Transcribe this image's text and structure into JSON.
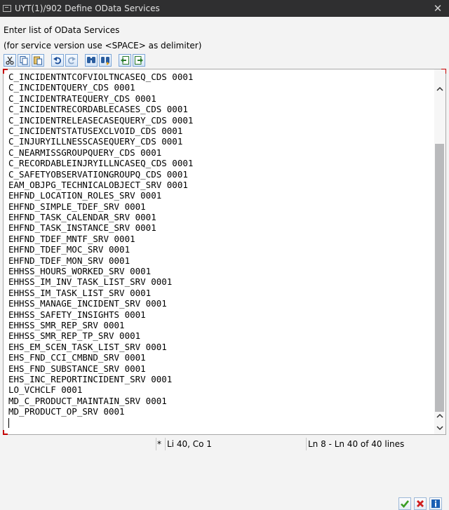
{
  "window": {
    "title": "UYT(1)/902 Define OData Services",
    "close_glyph": "✕"
  },
  "dialog": {
    "instruction": "Enter list of OData Services",
    "hint": "(for service version use <SPACE> as delimiter)"
  },
  "toolbar": [
    {
      "name": "cut-icon",
      "tooltip": "Cut"
    },
    {
      "name": "copy-icon",
      "tooltip": "Copy"
    },
    {
      "name": "paste-icon",
      "tooltip": "Paste"
    },
    {
      "name": "undo-icon",
      "tooltip": "Undo"
    },
    {
      "name": "redo-icon",
      "tooltip": "Redo"
    },
    {
      "name": "find-icon",
      "tooltip": "Find"
    },
    {
      "name": "find-next-icon",
      "tooltip": "Find next"
    },
    {
      "name": "import-icon",
      "tooltip": "Upload"
    },
    {
      "name": "export-icon",
      "tooltip": "Download"
    }
  ],
  "editor": {
    "lines": [
      "C_INCIDENTNTCOFVIOLTNCASEQ_CDS 0001",
      "C_INCIDENTQUERY_CDS 0001",
      "C_INCIDENTRATEQUERY_CDS 0001",
      "C_INCIDENTRECORDABLECASES_CDS 0001",
      "C_INCIDENTRELEASECASEQUERY_CDS 0001",
      "C_INCIDENTSTATUSEXCLVOID_CDS 0001",
      "C_INJURYILLNESSCASEQUERY_CDS 0001",
      "C_NEARMISSGROUPQUERY_CDS 0001",
      "C_RECORDABLEINJRYILLNCASEQ_CDS 0001",
      "C_SAFETYOBSERVATIONGROUPQ_CDS 0001",
      "EAM_OBJPG_TECHNICALOBJECT_SRV 0001",
      "EHFND_LOCATION_ROLES_SRV 0001",
      "EHFND_SIMPLE_TDEF_SRV 0001",
      "EHFND_TASK_CALENDAR_SRV 0001",
      "EHFND_TASK_INSTANCE_SRV 0001",
      "EHFND_TDEF_MNTF_SRV 0001",
      "EHFND_TDEF_MOC_SRV 0001",
      "EHFND_TDEF_MON_SRV 0001",
      "EHHSS_HOURS_WORKED_SRV 0001",
      "EHHSS_IM_INV_TASK_LIST_SRV 0001",
      "EHHSS_IM_TASK_LIST_SRV 0001",
      "EHHSS_MANAGE_INCIDENT_SRV 0001",
      "EHHSS_SAFETY_INSIGHTS 0001",
      "EHHSS_SMR_REP_SRV 0001",
      "EHHSS_SMR_REP_TP_SRV 0001",
      "EHS_EM_SCEN_TASK_LIST_SRV 0001",
      "EHS_FND_CCI_CMBND_SRV 0001",
      "EHS_FND_SUBSTANCE_SRV 0001",
      "EHS_INC_REPORTINCIDENT_SRV 0001",
      "LO_VCHCLF 0001",
      "MD_C_PRODUCT_MAINTAIN_SRV 0001",
      "MD_PRODUCT_OP_SRV 0001"
    ],
    "scroll_position": 0.82
  },
  "status": {
    "insert_mark": "*",
    "cursor": "Li 40, Co 1",
    "lines_info": "Ln 8 - Ln 40 of 40 lines"
  },
  "footer_buttons": [
    {
      "name": "confirm-button",
      "icon": "check-icon",
      "color": "#3a9d23"
    },
    {
      "name": "cancel-button",
      "icon": "cancel-icon",
      "color": "#d01f1f"
    },
    {
      "name": "info-button",
      "icon": "info-icon",
      "color": "#1a5fb4"
    }
  ]
}
